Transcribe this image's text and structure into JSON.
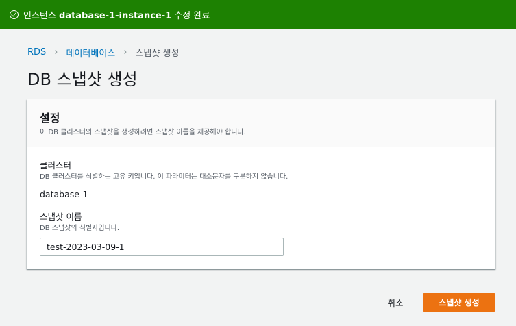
{
  "banner": {
    "prefix": "인스턴스 ",
    "instance_name": "database-1-instance-1",
    "suffix": " 수정 완료",
    "icon": "check-circle-icon",
    "color": "#1d8102"
  },
  "breadcrumb": {
    "items": [
      "RDS",
      "데이터베이스",
      "스냅샷 생성"
    ]
  },
  "page": {
    "title": "DB 스냅샷 생성"
  },
  "settings": {
    "title": "설정",
    "description": "이 DB 클러스터의 스냅샷을 생성하려면 스냅샷 이름을 제공해야 합니다.",
    "cluster": {
      "label": "클러스터",
      "description": "DB 클러스터를 식별하는 고유 키입니다. 이 파라미터는 대소문자를 구분하지 않습니다.",
      "value": "database-1"
    },
    "snapshot_name": {
      "label": "스냅샷 이름",
      "description": "DB 스냅샷의 식별자입니다.",
      "value": "test-2023-03-09-1"
    }
  },
  "actions": {
    "cancel_label": "취소",
    "create_label": "스냅샷 생성",
    "primary_color": "#ec7211"
  }
}
